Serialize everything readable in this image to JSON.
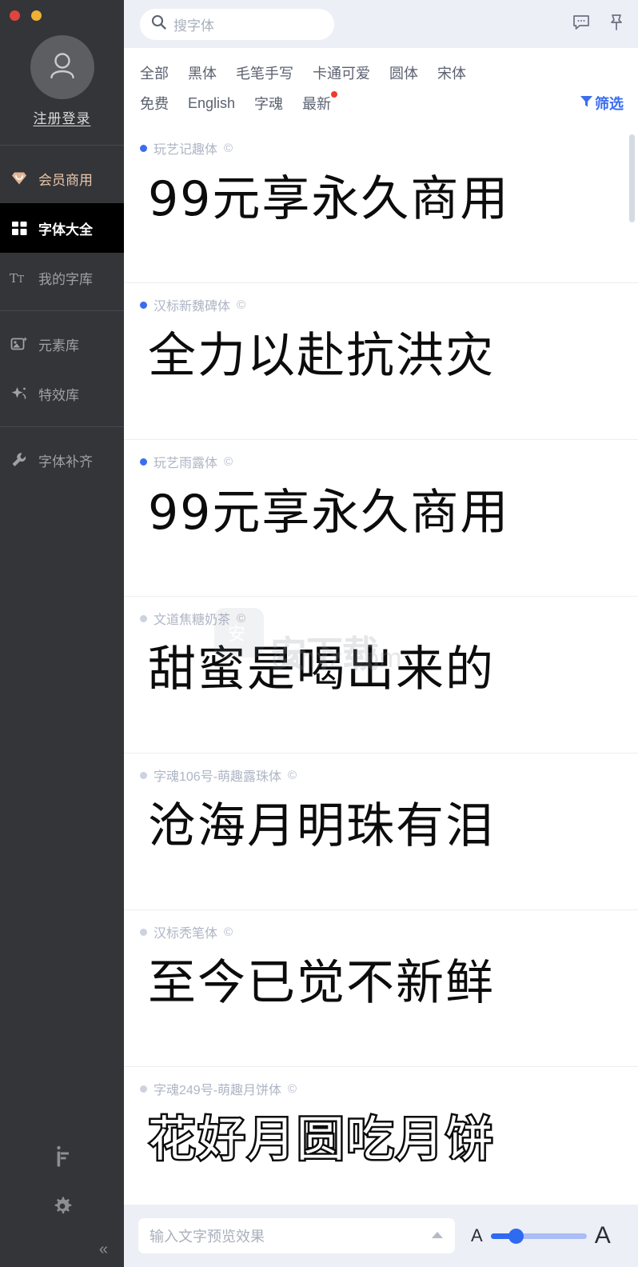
{
  "window": {
    "close_label": "close",
    "minimize_label": "minimize"
  },
  "sidebar": {
    "login_label": "注册登录",
    "avatar_icon": "user-avatar-icon",
    "nav": [
      {
        "label": "会员商用",
        "icon": "diamond-icon",
        "state": "vip"
      },
      {
        "label": "字体大全",
        "icon": "grid-icon",
        "state": "active"
      },
      {
        "label": "我的字库",
        "icon": "tt-icon",
        "state": "normal"
      },
      {
        "label": "元素库",
        "icon": "image-sparkle-icon",
        "state": "normal"
      },
      {
        "label": "特效库",
        "icon": "magic-star-icon",
        "state": "normal"
      },
      {
        "label": "字体补齐",
        "icon": "wrench-icon",
        "state": "normal"
      }
    ],
    "bottom": {
      "brand_icon": "font-brand-icon",
      "settings_icon": "gear-icon",
      "collapse_label": "«"
    }
  },
  "topbar": {
    "search_placeholder": "搜字体",
    "search_value": "",
    "search_icon": "search-icon",
    "feedback_icon": "comment-icon",
    "pin_icon": "pin-icon"
  },
  "filters": {
    "row1": [
      {
        "label": "全部",
        "badge": false
      },
      {
        "label": "黑体",
        "badge": false
      },
      {
        "label": "毛笔手写",
        "badge": false
      },
      {
        "label": "卡通可爱",
        "badge": false
      },
      {
        "label": "圆体",
        "badge": false
      },
      {
        "label": "宋体",
        "badge": false
      }
    ],
    "row2": [
      {
        "label": "免费",
        "badge": false
      },
      {
        "label": "English",
        "badge": false
      },
      {
        "label": "字魂",
        "badge": false
      },
      {
        "label": "最新",
        "badge": true
      }
    ],
    "filter_button_label": "筛选",
    "filter_button_icon": "funnel-icon",
    "accent_color": "#3a6df0",
    "badge_color": "#f03a2e"
  },
  "fonts": [
    {
      "name": "玩艺记趣体",
      "copyright": "©",
      "installed": true,
      "preview": "99元享永久商用",
      "style": "rounded"
    },
    {
      "name": "汉标新魏碑体",
      "copyright": "©",
      "installed": true,
      "preview": "全力以赴抗洪灾",
      "style": "brush"
    },
    {
      "name": "玩艺雨露体",
      "copyright": "©",
      "installed": true,
      "preview": "99元享永久商用",
      "style": "rounded"
    },
    {
      "name": "文道焦糖奶茶",
      "copyright": "©",
      "installed": false,
      "preview": "甜蜜是喝出来的",
      "style": "handwrite"
    },
    {
      "name": "字魂106号-萌趣露珠体",
      "copyright": "©",
      "installed": false,
      "preview": "沧海月明珠有泪",
      "style": "cute"
    },
    {
      "name": "汉标秃笔体",
      "copyright": "©",
      "installed": false,
      "preview": "至今已觉不新鲜",
      "style": "thin"
    },
    {
      "name": "字魂249号-萌趣月饼体",
      "copyright": "©",
      "installed": false,
      "preview": "花好月圆吃月饼",
      "style": "outline"
    }
  ],
  "watermark": {
    "title": "安下载",
    "url": "canxz.com"
  },
  "bottombar": {
    "preview_placeholder": "输入文字预览效果",
    "preview_value": "",
    "expand_icon": "caret-up-icon",
    "size_small_label": "A",
    "size_large_label": "A",
    "slider_value": 22,
    "slider_accent": "#2f6bf0"
  }
}
